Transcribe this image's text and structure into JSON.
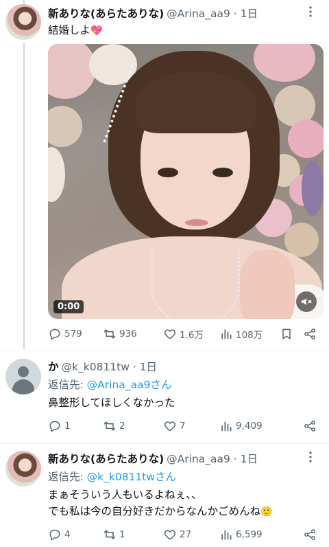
{
  "tweets": [
    {
      "name": "新ありな(あらたありな)",
      "handle": "@Arina_aa9 · 1日",
      "text": "結婚しよ",
      "emoji": "💖",
      "video_time": "0:00",
      "actions": {
        "reply": "579",
        "retweet": "936",
        "like": "1.6万",
        "views": "108万"
      }
    },
    {
      "name": "か",
      "handle": "@k_k0811tw · 1日",
      "reply_prefix": "返信先: ",
      "reply_mention": "@Arina_aa9さん",
      "text": "鼻整形してほしくなかった",
      "actions": {
        "reply": "1",
        "retweet": "2",
        "like": "7",
        "views": "9,409"
      }
    },
    {
      "name": "新ありな(あらたありな)",
      "handle": "@Arina_aa9 · 1日",
      "reply_prefix": "返信先: ",
      "reply_mention": "@k_k0811twさん",
      "text_line1": "まぁそういう人もいるよねぇ、、",
      "text_line2": "でも私は今の自分好きだからなんかごめんね",
      "emoji": "🙂",
      "actions": {
        "reply": "4",
        "retweet": "1",
        "like": "27",
        "views": "6,599"
      }
    }
  ],
  "colors": {
    "accent": "#1d9bf0",
    "secondary_text": "#536471",
    "divider": "#eff3f4"
  },
  "icons": [
    "more-icon",
    "reply-icon",
    "retweet-icon",
    "like-icon",
    "views-icon",
    "bookmark-icon",
    "share-icon",
    "mute-icon"
  ]
}
